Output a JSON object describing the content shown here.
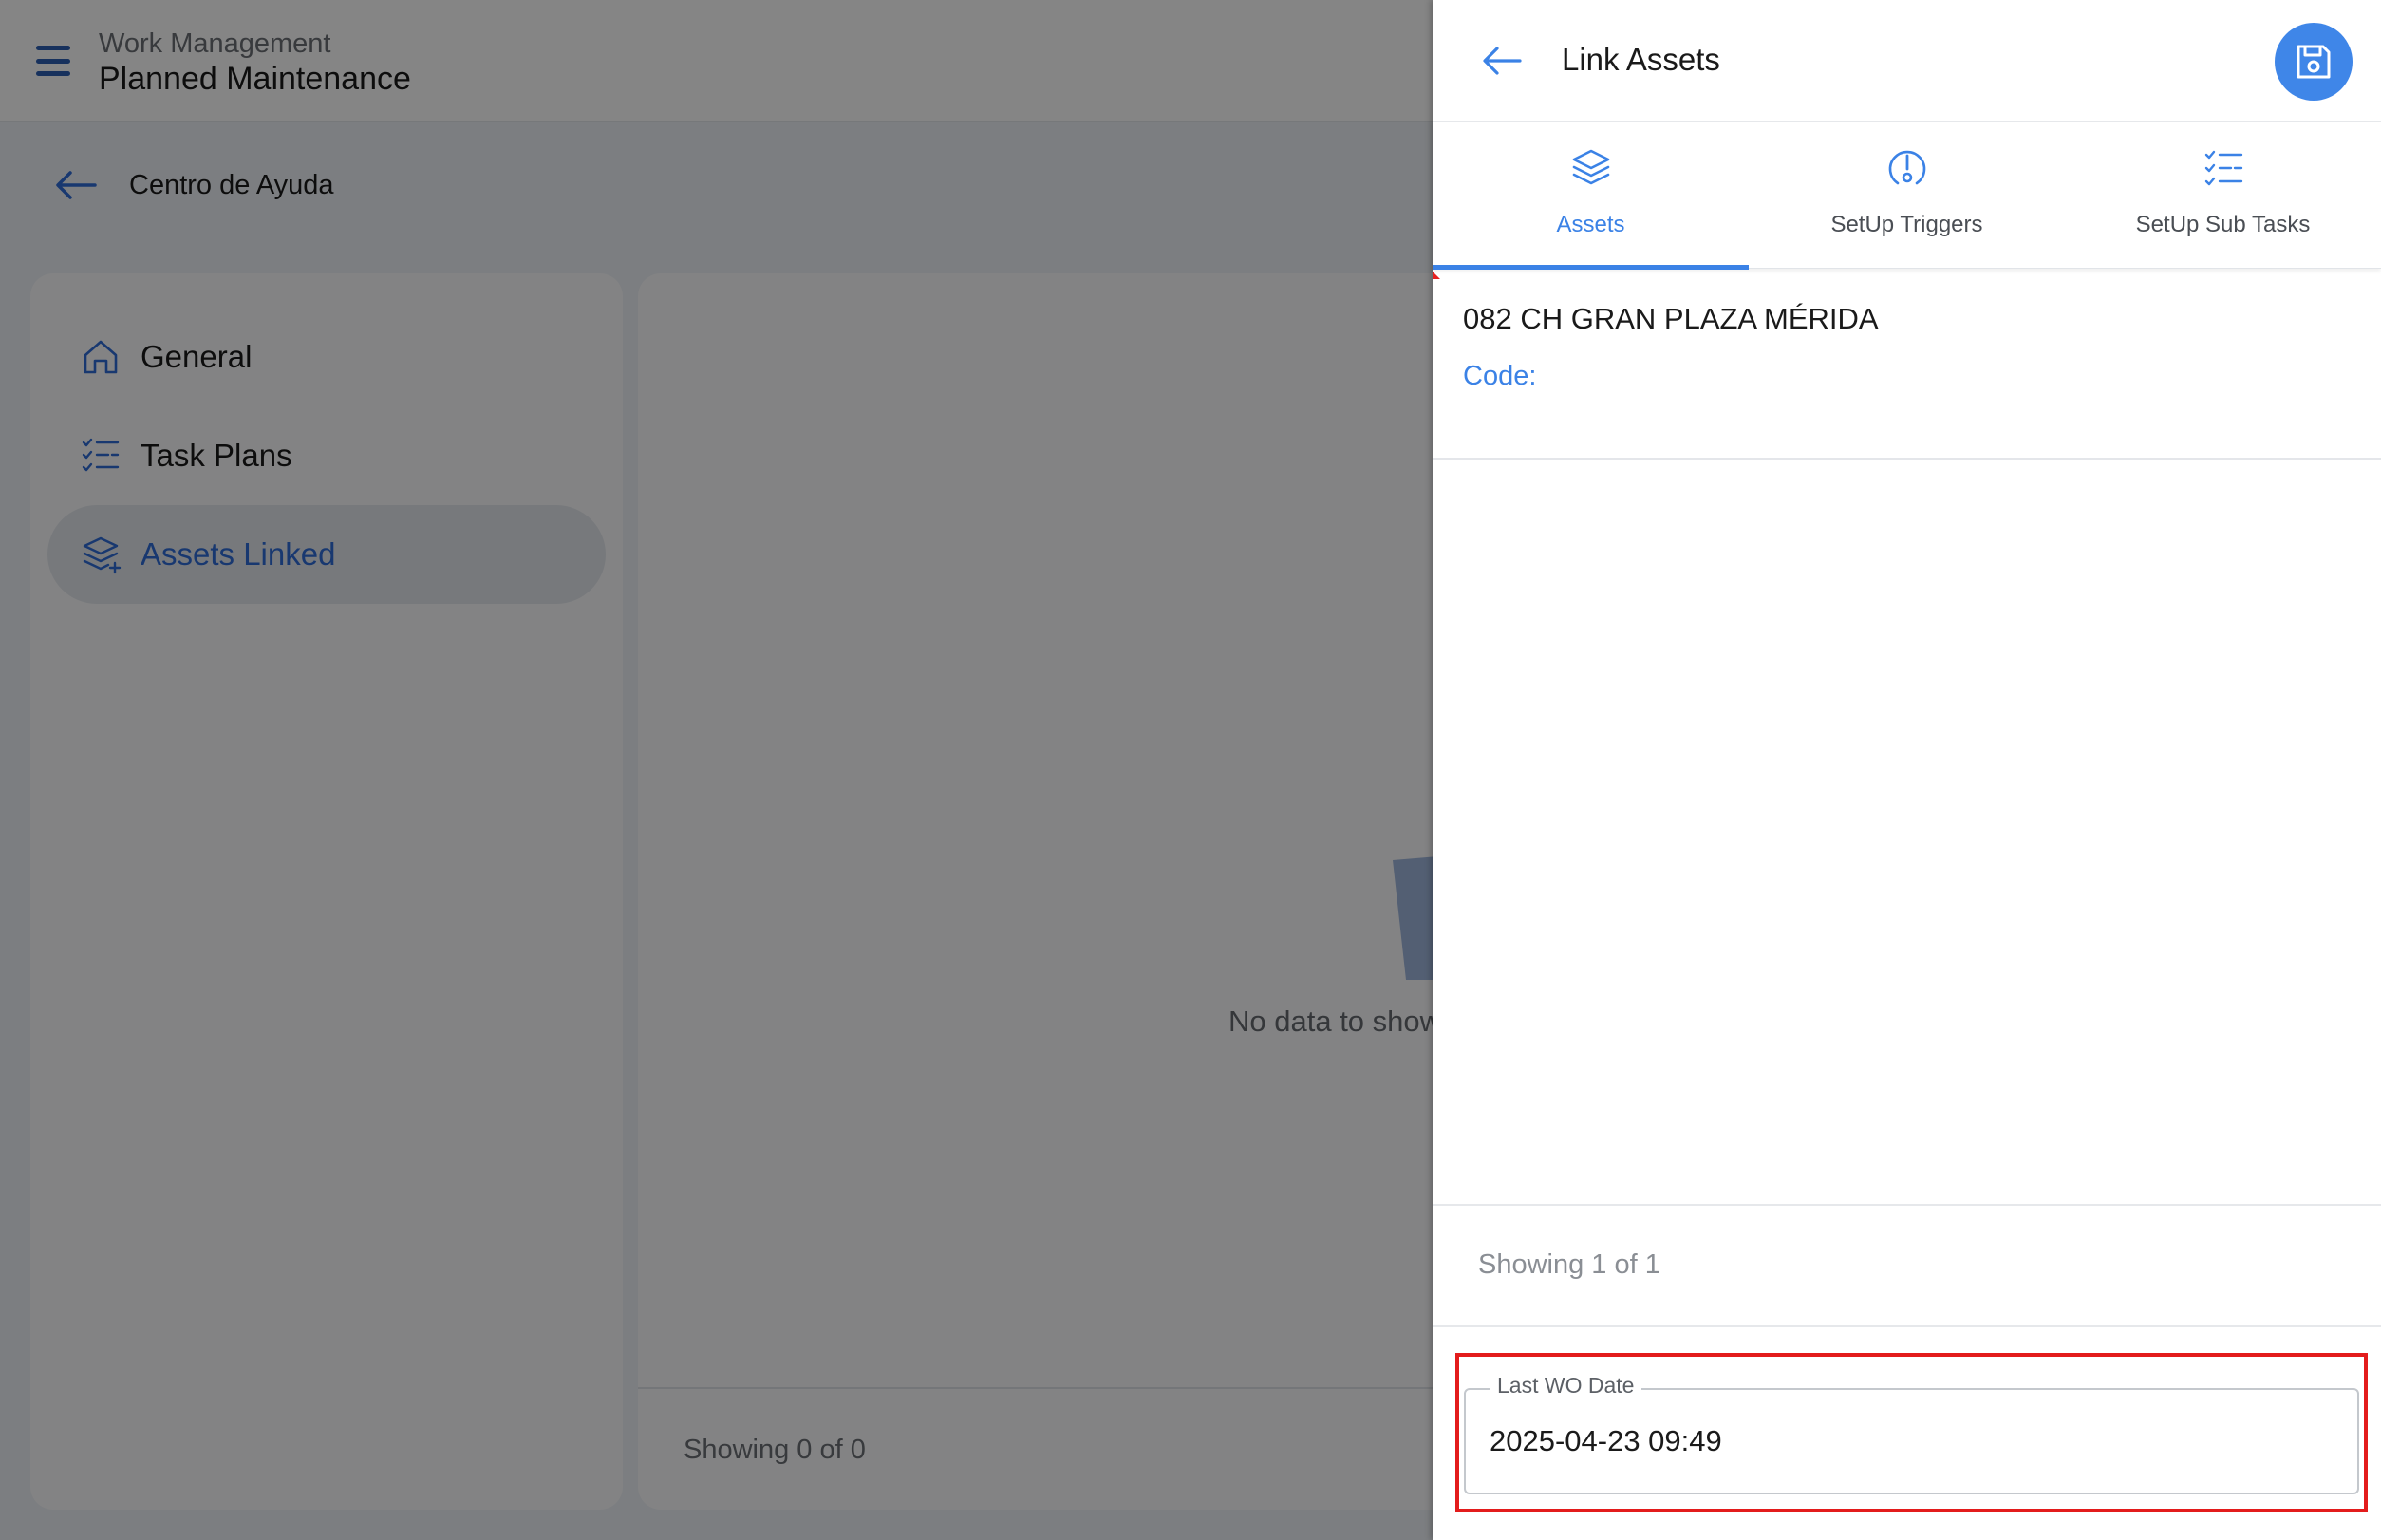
{
  "app": {
    "subtitle": "Work Management",
    "title": "Planned Maintenance"
  },
  "breadcrumb": {
    "back_label": "Centro de Ayuda"
  },
  "sidebar": {
    "items": [
      {
        "label": "General",
        "icon": "home-icon",
        "active": false
      },
      {
        "label": "Task Plans",
        "icon": "checklist-icon",
        "active": false
      },
      {
        "label": "Assets Linked",
        "icon": "layers-icon",
        "active": true
      }
    ]
  },
  "main": {
    "empty_text": "No data to show",
    "footer_count": "Showing 0 of 0"
  },
  "drawer": {
    "title": "Link Assets",
    "tabs": [
      {
        "label": "Assets",
        "icon": "layers-icon",
        "active": true
      },
      {
        "label": "SetUp Triggers",
        "icon": "trigger-alert-icon",
        "active": false
      },
      {
        "label": "SetUp Sub Tasks",
        "icon": "checklist-icon",
        "active": false
      }
    ],
    "asset": {
      "name": "082 CH GRAN PLAZA MÉRIDA",
      "code_label": "Code:"
    },
    "footer_count": "Showing 1 of 1",
    "last_wo_date": {
      "label": "Last WO Date",
      "value": "2025-04-23 09:49"
    }
  },
  "colors": {
    "accent": "#3b82e6",
    "primary_dark": "#2c5fb3",
    "highlight": "#e31c1c"
  }
}
